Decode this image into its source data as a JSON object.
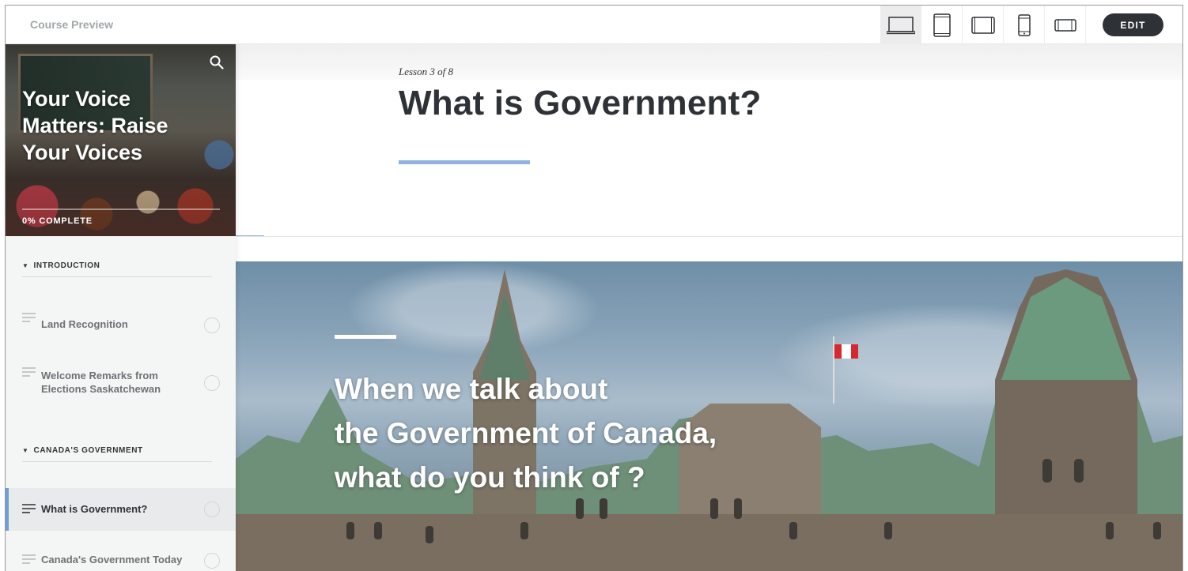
{
  "topbar": {
    "title": "Course Preview",
    "edit_label": "EDIT",
    "devices": [
      "laptop-icon",
      "tablet-portrait-icon",
      "tablet-landscape-icon",
      "phone-portrait-icon",
      "phone-landscape-icon"
    ]
  },
  "sidebar": {
    "course_title": "Your Voice Matters: Raise Your Voices",
    "progress_label": "0% COMPLETE",
    "progress_fraction": 0,
    "sections": [
      {
        "title": "INTRODUCTION",
        "lessons": [
          {
            "name": "Land Recognition"
          },
          {
            "name": "Welcome Remarks from Elections Saskatchewan"
          }
        ]
      },
      {
        "title": "CANADA'S GOVERNMENT",
        "lessons": [
          {
            "name": "What is Government?"
          },
          {
            "name": "Canada's Government Today"
          }
        ]
      }
    ]
  },
  "main": {
    "lesson_count": "Lesson 3 of 8",
    "lesson_title": "What is Government?",
    "quote_lines": [
      "When we talk about",
      "the Government of Canada,",
      "what do you think of ?"
    ]
  },
  "colors": {
    "accent": "#8fb2de",
    "active_bar": "#6f9fd8",
    "edit_button": "#2e3236"
  }
}
